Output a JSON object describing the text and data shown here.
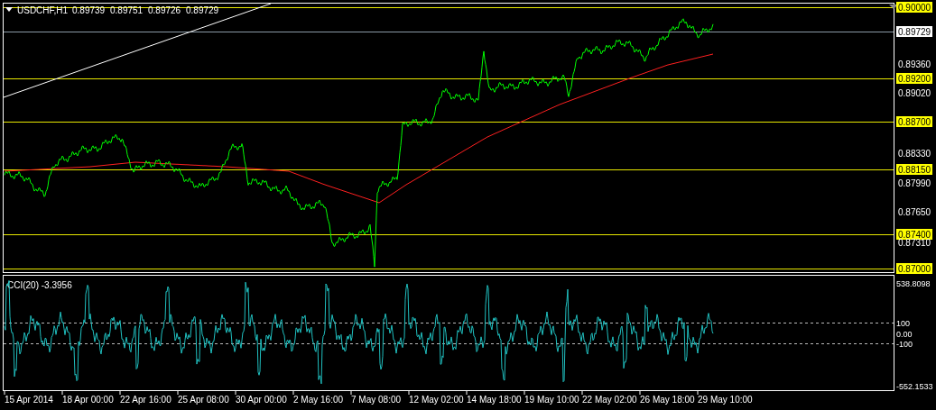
{
  "header": {
    "symbol": "USDCHF,H1",
    "quotes": [
      "0.89739",
      "0.89751",
      "0.89726",
      "0.89729"
    ]
  },
  "price_axis": [
    {
      "label": "0.90000",
      "kind": "level"
    },
    {
      "label": "0.89729",
      "kind": "current"
    },
    {
      "label": "0.89360",
      "kind": "tick"
    },
    {
      "label": "0.89200",
      "kind": "level"
    },
    {
      "label": "0.89020",
      "kind": "tick"
    },
    {
      "label": "0.88700",
      "kind": "level"
    },
    {
      "label": "0.88330",
      "kind": "tick"
    },
    {
      "label": "0.88150",
      "kind": "level"
    },
    {
      "label": "0.87990",
      "kind": "tick"
    },
    {
      "label": "0.87650",
      "kind": "tick"
    },
    {
      "label": "0.87400",
      "kind": "level"
    },
    {
      "label": "0.87310",
      "kind": "tick"
    },
    {
      "label": "0.87000",
      "kind": "level"
    }
  ],
  "indicator": {
    "label": "CCI(20) -3.3956",
    "axis": [
      {
        "label": "538.8098",
        "kind": "tick"
      },
      {
        "label": "100",
        "kind": "dashed"
      },
      {
        "label": "0.00",
        "kind": "tick"
      },
      {
        "label": "-100",
        "kind": "dashed"
      },
      {
        "label": "-552.1533",
        "kind": "tick"
      }
    ]
  },
  "time_axis": [
    "15 Apr 2014",
    "18 Apr 00:00",
    "22 Apr 16:00",
    "25 Apr 08:00",
    "30 Apr 00:00",
    "2 May 16:00",
    "7 May 08:00",
    "12 May 02:00",
    "14 May 18:00",
    "19 May 10:00",
    "22 May 02:00",
    "26 May 18:00",
    "29 May 10:00"
  ]
}
